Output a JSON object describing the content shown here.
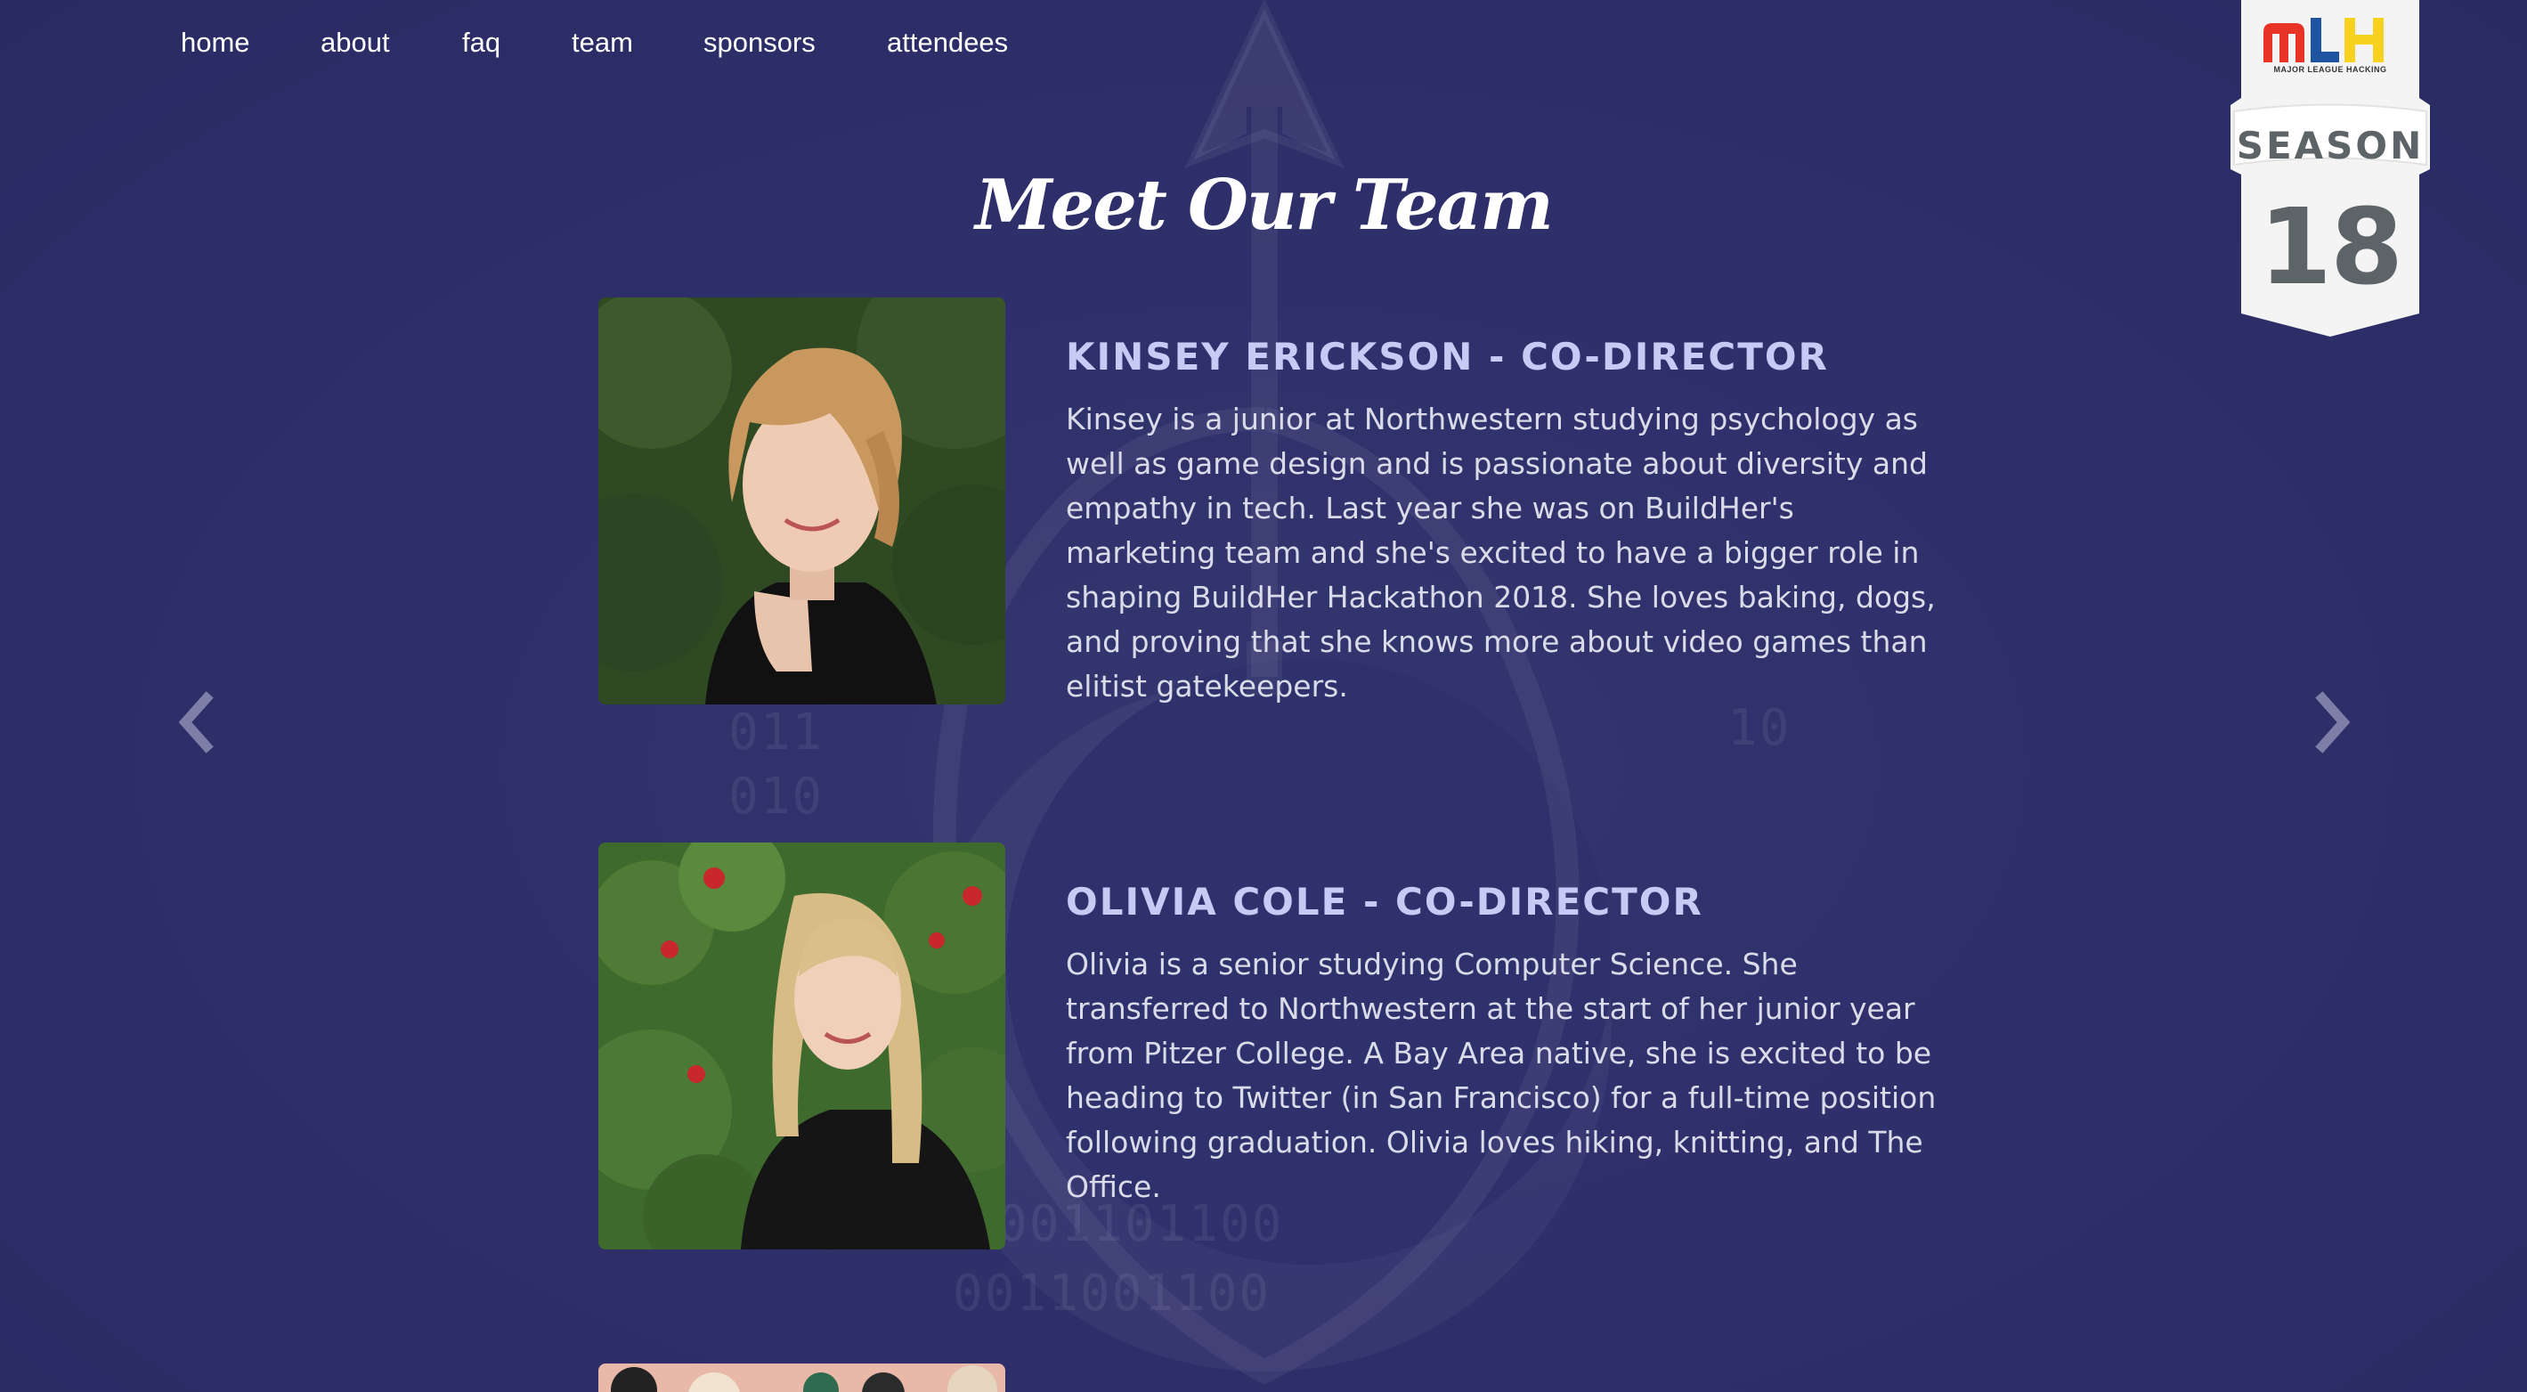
{
  "nav": {
    "items": [
      {
        "label": "home"
      },
      {
        "label": "about"
      },
      {
        "label": "faq"
      },
      {
        "label": "team"
      },
      {
        "label": "sponsors"
      },
      {
        "label": "attendees"
      }
    ]
  },
  "badge": {
    "logo": "MLH",
    "tagline": "MAJOR LEAGUE HACKING",
    "season_label": "SEASON",
    "season_number": "18"
  },
  "team": {
    "title": "Meet Our Team",
    "members": [
      {
        "name": "Kinsey Erickson - Co-Director",
        "bio": "Kinsey is a junior at Northwestern studying psychology as well as game design and is passionate about diversity and empathy in tech. Last year she was on BuildHer's marketing team and she's excited to have a bigger role in shaping BuildHer Hackathon 2018. She loves baking, dogs, and proving that she knows more about video games than elitist gatekeepers."
      },
      {
        "name": "Olivia Cole - Co-Director",
        "bio": "Olivia is a senior studying Computer Science. She transferred to Northwestern at the start of her junior year from Pitzer College. A Bay Area native, she is excited to be heading to Twitter (in San Francisco) for a full-time position following graduation. Olivia loves hiking, knitting, and The Office."
      }
    ]
  },
  "carousel": {
    "prev_icon": "chevron-left-icon",
    "next_icon": "chevron-right-icon"
  },
  "colors": {
    "background": "#2e2f6a",
    "name_color": "#c6cbf5",
    "bio_color": "#d9dbe9",
    "badge_gray": "#5d6467",
    "mlh_red": "#e73427",
    "mlh_blue": "#1d539f",
    "mlh_yellow": "#f6d21f"
  }
}
